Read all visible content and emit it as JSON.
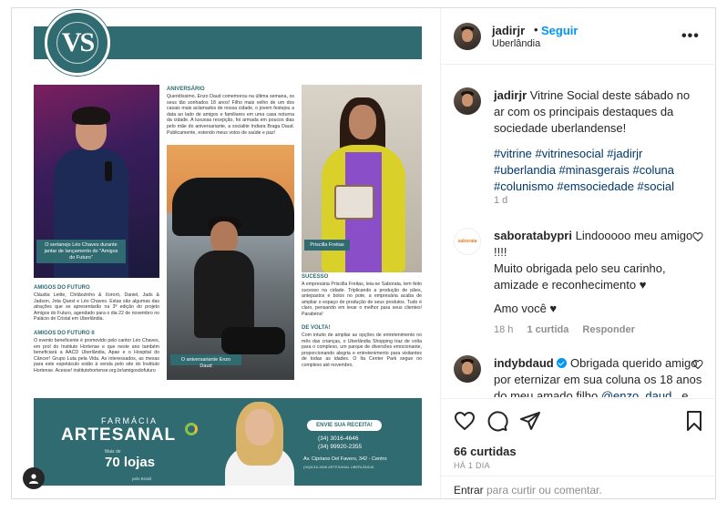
{
  "media": {
    "logo": "VS",
    "singer_caption": "O sertanejo Léo Chaves durante jantar de lançamento do \"Amigos do Futuro\"",
    "aniversario": {
      "title": "ANIVERSÁRIO",
      "body": "Queridíssimo, Enzo Daud comemorou na última semana, os seus tão sonhados 18 anos! Filho mais velho de um dos casais mais aclamados de nossa cidade, o jovem festejou a data ao lado de amigos e familiares em uma casa noturna da cidade. A luxuosa recepção, foi armada em poucos dias pelo mãe do aniversariante, a socialite Indiara Braga Daud. Publicamente, estendo meus votos de saúde e paz!"
    },
    "boy_caption": "O aniversariante Enzo Daud",
    "woman_caption": "Priscilla Freitas",
    "amigos": {
      "title": "AMIGOS DO FUTURO",
      "body": "Cláudia Leitte, Chitãozinho & Xororó, Daniel, Jads & Jadson, Jota Quest e Léo Chaves. Estas são algumas das atrações que se apresentarão na 3ª edição do projeto Amigos do Futuro, agendado para o dia 22 de novembro no Palácio de Cristal em Uberlândia."
    },
    "amigos2": {
      "title": "AMIGOS DO FUTURO II",
      "body": "O evento beneficente é promovido pelo cantor Léo Chaves, em prol do Instituto Hortense e que neste ano também beneficiará a AACD Uberlândia, Apae e o Hospital do Câncer! Grupo Luta pela Vida. As interessados, as mesas para este espetáculo estão à venda pelo site do Instituto Hortense. Acesse! institutohortense.org.br/amigosdofuturo"
    },
    "sucesso": {
      "title": "SUCESSO",
      "body": "A empresária Priscilla Freitas, leia-se Saborata, tem feito sucesso na cidade. Triplicando a produção de pães, antepastos e bolos no pote, a empresária acaba de ampliar o espaço de produção de seus produtos. Tudo é claro, pensando em levar o melhor para seus clientes! Parabéns!"
    },
    "devolta": {
      "title": "DE VOLTA!",
      "body": "Com intuito de ampliar as opções de entretenimento no mês das crianças, o Uberlândia Shopping traz de volta para o complexo, um parque de diversões emocionante, proporcionando alegria e entretenimento para visitantes de todas as idades. O Ita Center Park segue no complexo até novembro."
    },
    "ad": {
      "farmacia": "FARMÁCIA",
      "artesanal": "ARTESANAL",
      "mais_de": "Mais de",
      "lojas": "70 lojas",
      "lojas_sub": "pelo Brasil",
      "cta": "ENVIE SUA RECEITA!",
      "phone1": "(34) 3016-4646",
      "phone2": "(34) 99920-2355",
      "address": "Av. Cipriano Del Favero, 342 - Centro",
      "small": "(34)3016-4646 ARTESANAL UBERLÂNDIA"
    }
  },
  "header": {
    "username": "jadirjr",
    "follow_label": "Seguir",
    "location": "Uberlândia",
    "more_label": "•••"
  },
  "caption": {
    "username": "jadirjr",
    "text": "Vitrine Social deste sábado no ar com os principais destaques da sociedade uberlandense!",
    "hashtags": "#vitrine #vitrinesocial #jadirjr #uberlandia #minasgerais #coluna #colunismo #emsociedade #social",
    "time": "1 d"
  },
  "comments": [
    {
      "username": "saboratabypri",
      "avatar_text": "saborata",
      "line1": "Lindooooo meu amigo !!!!",
      "line2": "Muito obrigada pelo seu carinho, amizade e reconhecimento ♥",
      "line3": "Amo você ♥",
      "time": "18 h",
      "likes": "1 curtida",
      "reply": "Responder"
    },
    {
      "username": "indybdaud",
      "text": "Obrigada querido amigo por eternizar em sua coluna os 18 anos do meu amado filho",
      "mention": "@enzo_daud_",
      "tail": "e um"
    }
  ],
  "actions": {
    "likes": "66 curtidas",
    "time_ago": "HÁ 1 DIA",
    "enter_label": "Entrar",
    "comment_placeholder": "para curtir ou comentar."
  },
  "colors": {
    "brand_teal": "#2f6b70",
    "link_blue": "#0095f6",
    "hashtag_blue": "#00376b"
  }
}
